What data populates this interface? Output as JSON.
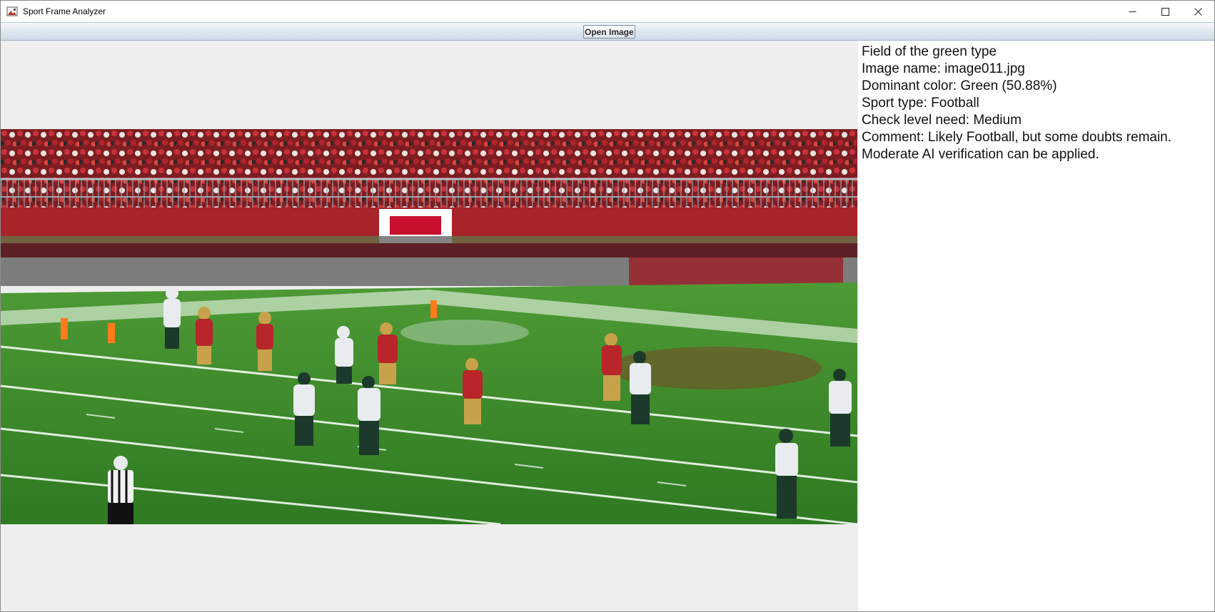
{
  "window": {
    "title": "Sport Frame Analyzer",
    "app_icon": "image-icon",
    "controls": [
      "minimize-icon",
      "maximize-icon",
      "close-icon"
    ]
  },
  "toolbar": {
    "open_image_label": "Open Image"
  },
  "info": {
    "field_type": "Field of the green type",
    "image_name": "Image name: image011.jpg",
    "dominant_color": "Dominant color: Green (50.88%)",
    "sport_type": "Sport type: Football",
    "check_level": "Check level need: Medium",
    "comment": "Comment: Likely Football, but some doubts remain.",
    "comment_2": "Moderate AI verification can be applied."
  },
  "colors": {
    "field_green": "#3f8a2c",
    "stand_red": "#b8252b",
    "panel_bg": "#eeeeee",
    "info_bg": "#ffffff"
  }
}
